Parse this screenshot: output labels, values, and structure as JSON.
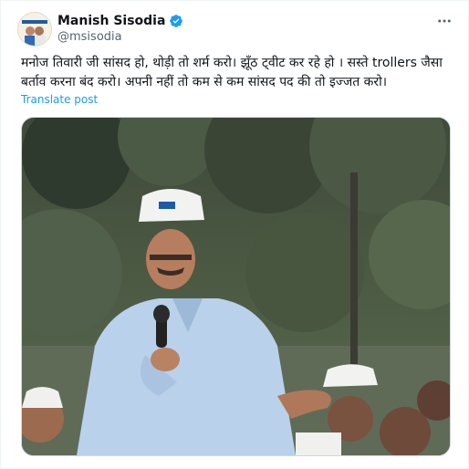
{
  "tweet": {
    "author_name": "Manish Sisodia",
    "handle": "@msisodia",
    "text": "मनोज तिवारी जी सांसद हो, थोड़ी तो शर्म करो। झूँठ ट्वीट कर रहे हो । सस्ते trollers जैसा बर्ताव करना बंद करो। अपनी नहीं तो कम से कम सांसद पद की तो इज्जत करो।",
    "translate_label": "Translate post",
    "more_icon": "more-options-icon",
    "verified_icon": "verified-badge-icon"
  },
  "media": {
    "type": "video-frame",
    "description_icon": "speaker-photo"
  },
  "colors": {
    "link": "#1d9bf0",
    "secondary_text": "#536471",
    "verified": "#1d9bf0"
  }
}
